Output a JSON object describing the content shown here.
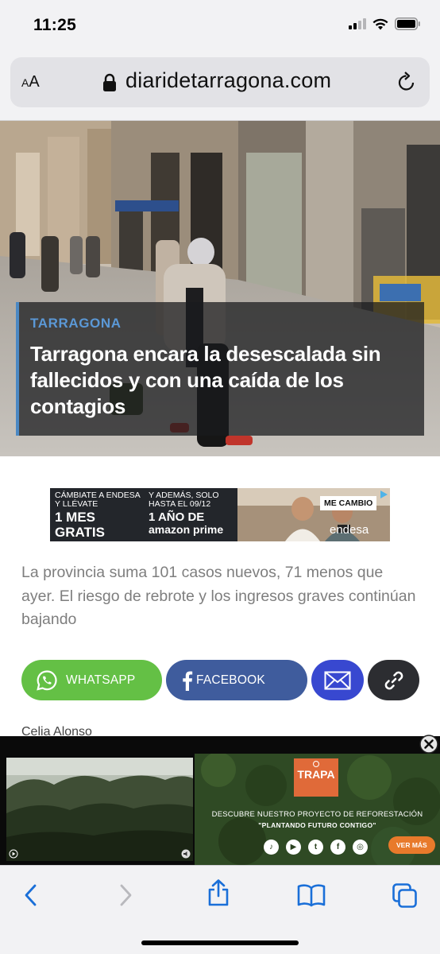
{
  "status_bar": {
    "time": "11:25",
    "icons": [
      "signal-icon",
      "wifi-icon",
      "battery-icon"
    ]
  },
  "browser": {
    "text_size_label": "AA",
    "url": "diaridetarragona.com",
    "icons": [
      "lock-icon",
      "reload-icon"
    ]
  },
  "hero": {
    "category": "TARRAGONA",
    "title": "Tarragona encara la desescalada sin fallecidos y con una caída de los contagios"
  },
  "ad_banner": {
    "left_line1": "CÁMBIATE A ENDESA",
    "left_line2": "Y LLÉVATE",
    "left_big1": "1 MES",
    "left_big2": "GRATIS",
    "mid_line1": "Y ADEMÁS, SOLO",
    "mid_line2": "HASTA EL 09/12",
    "mid_big": "1 AÑO DE",
    "mid_prime": "amazon prime",
    "cta": "ME CAMBIO",
    "brand": "endesa"
  },
  "summary": "La provincia suma 101 casos nuevos, 71 menos que ayer. El riesgo de rebrote y los ingresos graves continúan bajando",
  "share": {
    "whatsapp_label": "WHATSAPP",
    "facebook_label": "FACEBOOK",
    "colors": {
      "whatsapp": "#64c045",
      "facebook": "#3f5c9d",
      "email": "#3848d0",
      "link": "#2c2d31"
    }
  },
  "author": "Celia Alonso",
  "bottom_ad": {
    "brand": "TRAPA",
    "line1": "DESCUBRE NUESTRO PROYECTO DE REFORESTACIÓN",
    "line2": "\"PLANTANDO FUTURO CONTIGO\"",
    "cta": "VER MÁS"
  },
  "toolbar": {
    "icons": [
      "back-icon",
      "forward-icon",
      "share-icon",
      "bookmarks-icon",
      "tabs-icon"
    ]
  },
  "accent_colors": {
    "category": "#5b98d6",
    "caption_border": "#4b88c3"
  }
}
